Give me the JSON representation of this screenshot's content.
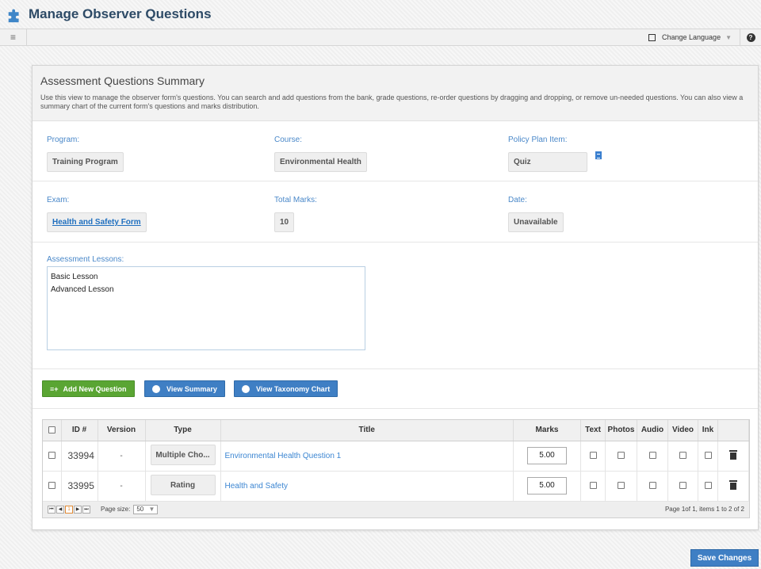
{
  "header": {
    "title": "Manage Observer Questions"
  },
  "toolbar": {
    "menu_icon": "hamburger-icon",
    "language_label": "Change Language",
    "help_label": "?"
  },
  "summary": {
    "title": "Assessment Questions Summary",
    "description": "Use this view to manage the observer form's questions. You can search and add questions from the bank, grade questions, re-order questions by dragging and dropping, or remove un-needed questions. You can also view a summary chart of the current form's questions and marks distribution."
  },
  "info": {
    "program_label": "Program:",
    "program_value": "Training Program",
    "course_label": "Course:",
    "course_value": "Environmental Health",
    "policy_label": "Policy Plan Item:",
    "policy_value": "Quiz",
    "exam_label": "Exam:",
    "exam_value": "Health and Safety Form",
    "total_marks_label": "Total Marks:",
    "total_marks_value": "10",
    "date_label": "Date:",
    "date_value": "Unavailable"
  },
  "lessons": {
    "label": "Assessment Lessons:",
    "items": [
      "Basic Lesson",
      "Advanced Lesson"
    ]
  },
  "buttons": {
    "add_prefix": "≡+",
    "add_question": "Add New Question",
    "view_summary": "View Summary",
    "view_taxonomy": "View Taxonomy Chart",
    "save": "Save Changes"
  },
  "grid": {
    "columns": [
      "ID #",
      "Version",
      "Type",
      "Title",
      "Marks",
      "Text",
      "Photos",
      "Audio",
      "Video",
      "Ink"
    ],
    "rows": [
      {
        "id": "33994",
        "version": "-",
        "type": "Multiple Cho...",
        "title": "Environmental Health Question 1",
        "marks": "5.00"
      },
      {
        "id": "33995",
        "version": "-",
        "type": "Rating",
        "title": "Health and Safety",
        "marks": "5.00"
      }
    ],
    "pager": {
      "first": "⏮",
      "prev": "◀",
      "page": "1",
      "next": "▶",
      "last": "⏭",
      "page_size_label": "Page size:",
      "page_size": "50",
      "info": "Page 1of 1, items 1 to 2 of 2"
    }
  },
  "colors": {
    "accent_blue": "#3f7fc4",
    "accent_green": "#5aa533",
    "label_blue": "#4a88c9",
    "title": "#2d4a66"
  }
}
